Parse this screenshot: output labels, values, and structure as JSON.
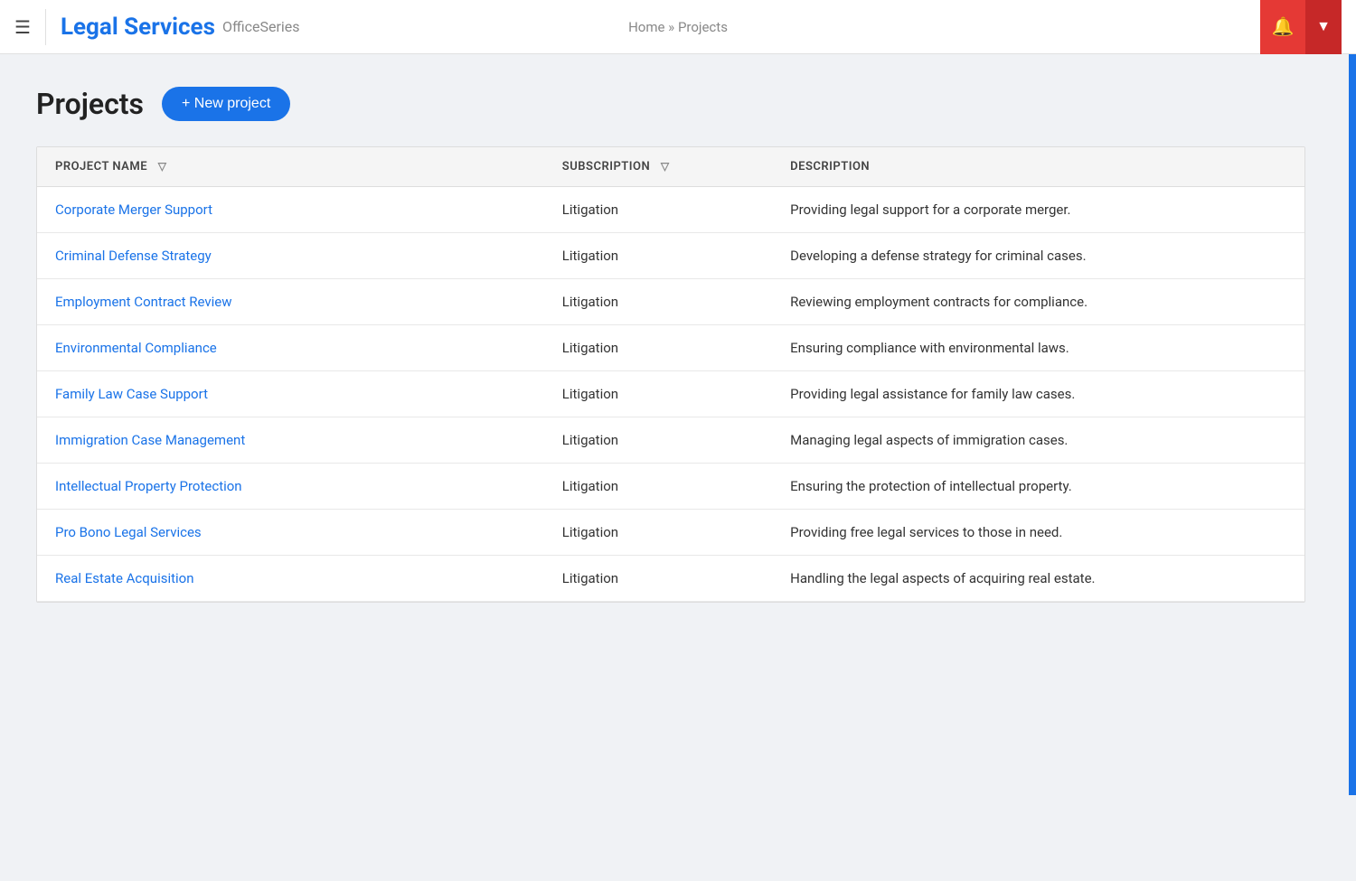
{
  "header": {
    "menu_label": "☰",
    "app_title": "Legal Services",
    "app_subtitle": "OfficeSeries",
    "breadcrumb_home": "Home",
    "breadcrumb_sep": "»",
    "breadcrumb_current": "Projects",
    "bell_icon": "🔔",
    "dropdown_icon": "▼"
  },
  "page": {
    "title": "Projects",
    "new_project_label": "+ New project"
  },
  "table": {
    "columns": [
      {
        "key": "name",
        "label": "PROJECT NAME",
        "filterable": true
      },
      {
        "key": "subscription",
        "label": "SUBSCRIPTION",
        "filterable": true
      },
      {
        "key": "description",
        "label": "DESCRIPTION",
        "filterable": false
      }
    ],
    "rows": [
      {
        "name": "Corporate Merger Support",
        "subscription": "Litigation",
        "description": "Providing legal support for a corporate merger."
      },
      {
        "name": "Criminal Defense Strategy",
        "subscription": "Litigation",
        "description": "Developing a defense strategy for criminal cases."
      },
      {
        "name": "Employment Contract Review",
        "subscription": "Litigation",
        "description": "Reviewing employment contracts for compliance."
      },
      {
        "name": "Environmental Compliance",
        "subscription": "Litigation",
        "description": "Ensuring compliance with environmental laws."
      },
      {
        "name": "Family Law Case Support",
        "subscription": "Litigation",
        "description": "Providing legal assistance for family law cases."
      },
      {
        "name": "Immigration Case Management",
        "subscription": "Litigation",
        "description": "Managing legal aspects of immigration cases."
      },
      {
        "name": "Intellectual Property Protection",
        "subscription": "Litigation",
        "description": "Ensuring the protection of intellectual property."
      },
      {
        "name": "Pro Bono Legal Services",
        "subscription": "Litigation",
        "description": "Providing free legal services to those in need."
      },
      {
        "name": "Real Estate Acquisition",
        "subscription": "Litigation",
        "description": "Handling the legal aspects of acquiring real estate."
      }
    ]
  }
}
